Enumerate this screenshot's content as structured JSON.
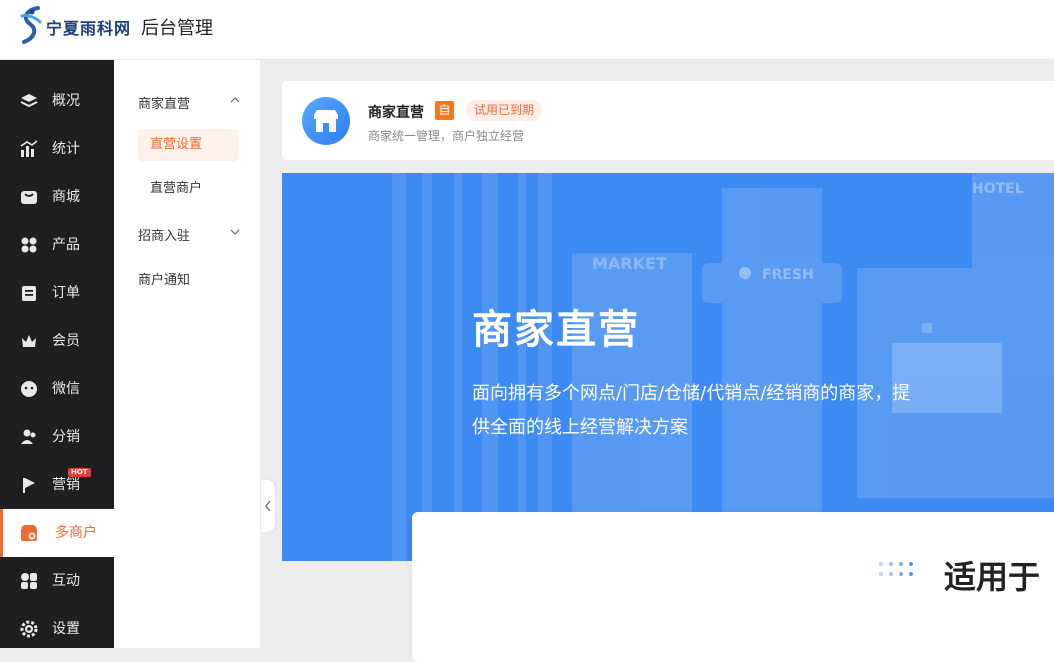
{
  "header": {
    "brand": "宁夏雨科网",
    "title": "后台管理"
  },
  "sidebar": {
    "items": [
      {
        "label": "概况",
        "icon": "layers-icon"
      },
      {
        "label": "统计",
        "icon": "chart-icon"
      },
      {
        "label": "商城",
        "icon": "store-icon"
      },
      {
        "label": "产品",
        "icon": "grid-icon"
      },
      {
        "label": "订单",
        "icon": "order-icon"
      },
      {
        "label": "会员",
        "icon": "crown-icon"
      },
      {
        "label": "微信",
        "icon": "wechat-icon"
      },
      {
        "label": "分销",
        "icon": "users-icon"
      },
      {
        "label": "营销",
        "icon": "flag-icon",
        "badge": "HOT"
      },
      {
        "label": "多商户",
        "icon": "shop-icon",
        "active": true
      },
      {
        "label": "互动",
        "icon": "interact-icon"
      },
      {
        "label": "设置",
        "icon": "gear-icon"
      }
    ]
  },
  "submenu": {
    "group1": "商家直营",
    "child1": "直营设置",
    "child2": "直营商户",
    "group2": "招商入驻",
    "item3": "商户通知"
  },
  "card": {
    "title": "商家直营",
    "self_tag": "自",
    "status": "试用已到期",
    "desc": "商家统一管理，商户独立经营"
  },
  "hero": {
    "title": "商家直营",
    "desc": "面向拥有多个网点/门店/仓储/代销点/经销商的商家，提供全面的线上经营解决方案",
    "sign_market": "MARKET",
    "sign_fresh": "FRESH",
    "sign_hotel": "HOTEL"
  },
  "info": {
    "heading": "适用于"
  },
  "colors": {
    "accent": "#ee6a34",
    "sidebar_bg": "#1f1f22",
    "hero_bg": "#3d8af2"
  }
}
